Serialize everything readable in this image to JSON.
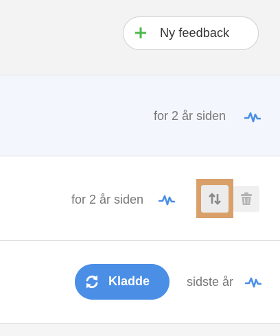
{
  "toolbar": {
    "new_feedback_label": "Ny feedback",
    "plus_icon": "plus-icon",
    "accent_green": "#4cb84c"
  },
  "rows": [
    {
      "time": "for 2 år siden",
      "activity_icon": "activity-pulse-icon"
    },
    {
      "time": "for 2 år siden",
      "activity_icon": "activity-pulse-icon",
      "actions": [
        "sort-icon",
        "trash-icon"
      ]
    },
    {
      "status": "Kladde",
      "status_icon": "refresh-icon",
      "time": "sidste år",
      "activity_icon": "activity-pulse-icon"
    }
  ],
  "colors": {
    "accent_blue": "#4a8ee6",
    "highlight_row": "#f3f7fd",
    "focus_outline": "#d9a06a"
  }
}
